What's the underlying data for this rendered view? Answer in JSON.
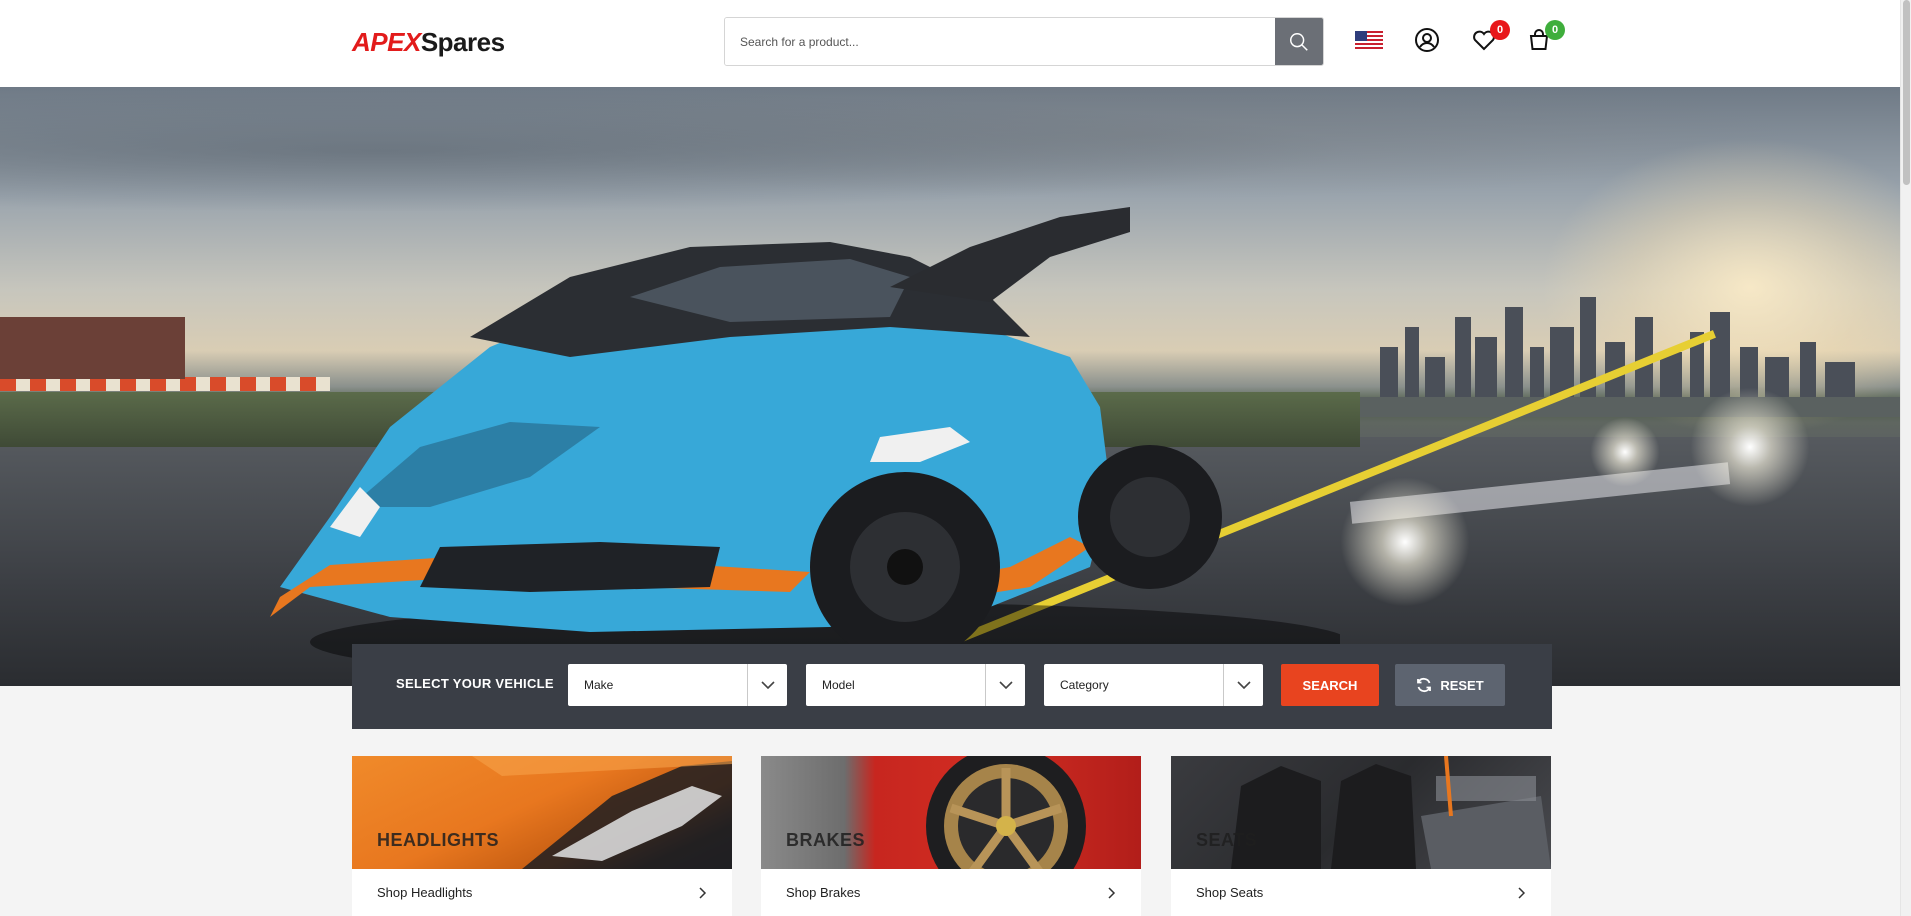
{
  "header": {
    "logo_primary": "APEX",
    "logo_secondary": "Spares",
    "search_placeholder": "Search for a product...",
    "search_icon": "search-icon",
    "flag_icon": "us-flag-icon",
    "account_icon": "user-icon",
    "wishlist_icon": "heart-icon",
    "wishlist_count": "0",
    "cart_icon": "shopping-bag-icon",
    "cart_count": "0"
  },
  "hero": {
    "slides_total": 3,
    "active_slide": 1
  },
  "selector": {
    "label": "SELECT YOUR VEHICLE",
    "make": "Make",
    "model": "Model",
    "category": "Category",
    "search_label": "SEARCH",
    "reset_label": "RESET"
  },
  "categories": [
    {
      "title": "HEADLIGHTS",
      "link": "Shop Headlights"
    },
    {
      "title": "BRAKES",
      "link": "Shop Brakes"
    },
    {
      "title": "SEATS",
      "link": "Shop Seats"
    }
  ],
  "colors": {
    "brand_red": "#e21b1b",
    "search_orange": "#e8441f",
    "selector_bg": "#3a3e46",
    "reset_bg": "#5d6470",
    "car_blue": "#37a8d8",
    "car_orange": "#e8771f"
  }
}
